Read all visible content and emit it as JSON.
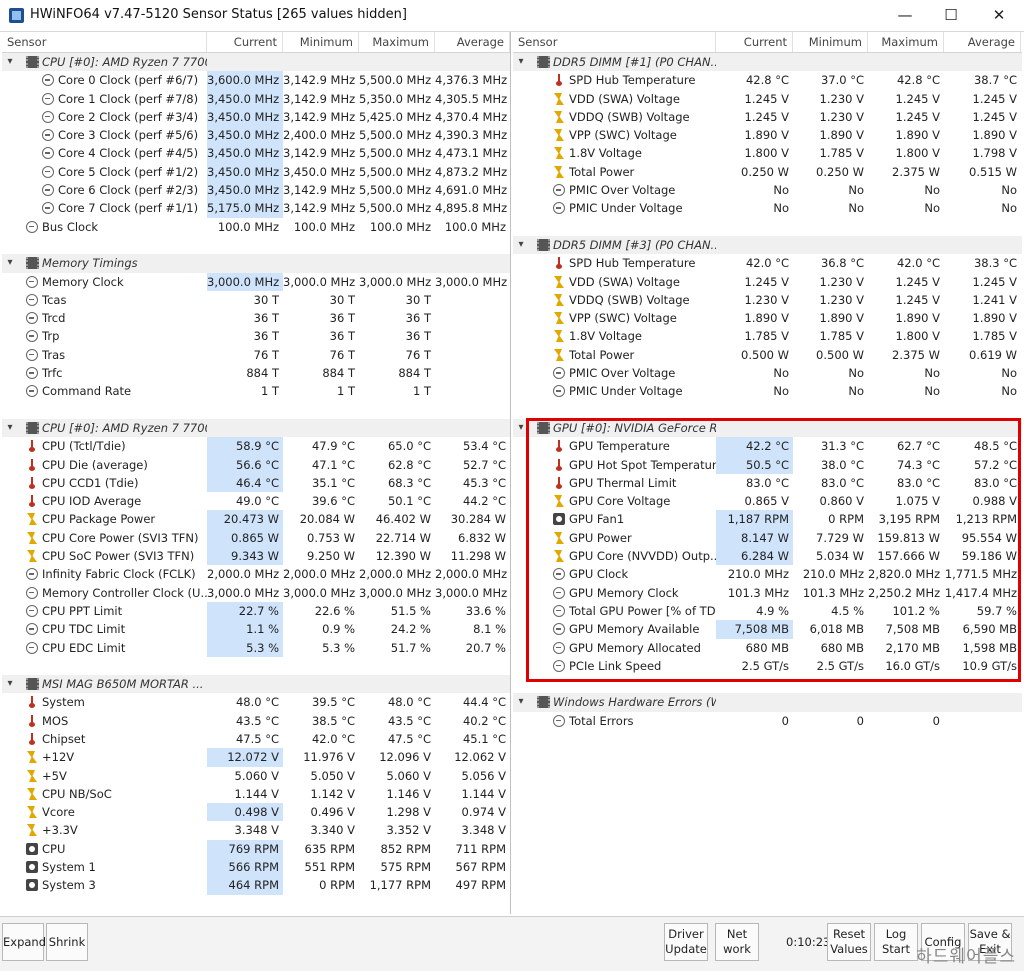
{
  "window": {
    "title": "HWiNFO64 v7.47-5120 Sensor Status [265 values hidden]",
    "minimize": "—",
    "maximize": "☐",
    "close": "✕"
  },
  "columns": [
    "Sensor",
    "Current",
    "Minimum",
    "Maximum",
    "Average"
  ],
  "left_rows": [
    {
      "type": "group",
      "name": "CPU [#0]: AMD Ryzen 7 7700X"
    },
    {
      "type": "item",
      "icon": "clock",
      "name": "Core 0 Clock (perf #6/7)",
      "cur": "3,600.0 MHz",
      "min": "3,142.9 MHz",
      "max": "5,500.0 MHz",
      "avg": "4,376.3 MHz",
      "hl": true
    },
    {
      "type": "item",
      "icon": "clock",
      "name": "Core 1 Clock (perf #7/8)",
      "cur": "3,450.0 MHz",
      "min": "3,142.9 MHz",
      "max": "5,350.0 MHz",
      "avg": "4,305.5 MHz",
      "hl": true
    },
    {
      "type": "item",
      "icon": "clock",
      "name": "Core 2 Clock (perf #3/4)",
      "cur": "3,450.0 MHz",
      "min": "3,142.9 MHz",
      "max": "5,425.0 MHz",
      "avg": "4,370.4 MHz",
      "hl": true
    },
    {
      "type": "item",
      "icon": "clock",
      "name": "Core 3 Clock (perf #5/6)",
      "cur": "3,450.0 MHz",
      "min": "2,400.0 MHz",
      "max": "5,500.0 MHz",
      "avg": "4,390.3 MHz",
      "hl": true
    },
    {
      "type": "item",
      "icon": "clock",
      "name": "Core 4 Clock (perf #4/5)",
      "cur": "3,450.0 MHz",
      "min": "3,142.9 MHz",
      "max": "5,500.0 MHz",
      "avg": "4,473.1 MHz",
      "hl": true
    },
    {
      "type": "item",
      "icon": "clock",
      "name": "Core 5 Clock (perf #1/2)",
      "cur": "3,450.0 MHz",
      "min": "3,450.0 MHz",
      "max": "5,500.0 MHz",
      "avg": "4,873.2 MHz",
      "hl": true
    },
    {
      "type": "item",
      "icon": "clock",
      "name": "Core 6 Clock (perf #2/3)",
      "cur": "3,450.0 MHz",
      "min": "3,142.9 MHz",
      "max": "5,500.0 MHz",
      "avg": "4,691.0 MHz",
      "hl": true
    },
    {
      "type": "item",
      "icon": "clock",
      "name": "Core 7 Clock (perf #1/1)",
      "cur": "5,175.0 MHz",
      "min": "3,142.9 MHz",
      "max": "5,500.0 MHz",
      "avg": "4,895.8 MHz",
      "hl": true
    },
    {
      "type": "item",
      "icon": "clock",
      "name": "Bus Clock",
      "cur": "100.0 MHz",
      "min": "100.0 MHz",
      "max": "100.0 MHz",
      "avg": "100.0 MHz",
      "lvl": 1
    },
    {
      "type": "empty"
    },
    {
      "type": "group",
      "name": "Memory Timings"
    },
    {
      "type": "item",
      "icon": "clock",
      "name": "Memory Clock",
      "cur": "3,000.0 MHz",
      "min": "3,000.0 MHz",
      "max": "3,000.0 MHz",
      "avg": "3,000.0 MHz",
      "hl": true,
      "lvl": 1
    },
    {
      "type": "item",
      "icon": "clock",
      "name": "Tcas",
      "cur": "30 T",
      "min": "30 T",
      "max": "30 T",
      "avg": "",
      "lvl": 1
    },
    {
      "type": "item",
      "icon": "clock",
      "name": "Trcd",
      "cur": "36 T",
      "min": "36 T",
      "max": "36 T",
      "avg": "",
      "lvl": 1
    },
    {
      "type": "item",
      "icon": "clock",
      "name": "Trp",
      "cur": "36 T",
      "min": "36 T",
      "max": "36 T",
      "avg": "",
      "lvl": 1
    },
    {
      "type": "item",
      "icon": "clock",
      "name": "Tras",
      "cur": "76 T",
      "min": "76 T",
      "max": "76 T",
      "avg": "",
      "lvl": 1
    },
    {
      "type": "item",
      "icon": "clock",
      "name": "Trfc",
      "cur": "884 T",
      "min": "884 T",
      "max": "884 T",
      "avg": "",
      "lvl": 1
    },
    {
      "type": "item",
      "icon": "clock",
      "name": "Command Rate",
      "cur": "1 T",
      "min": "1 T",
      "max": "1 T",
      "avg": "",
      "lvl": 1
    },
    {
      "type": "empty"
    },
    {
      "type": "group",
      "name": "CPU [#0]: AMD Ryzen 7 7700..."
    },
    {
      "type": "item",
      "icon": "temp",
      "name": "CPU (Tctl/Tdie)",
      "cur": "58.9 °C",
      "min": "47.9 °C",
      "max": "65.0 °C",
      "avg": "53.4 °C",
      "hl": true,
      "lvl": 1
    },
    {
      "type": "item",
      "icon": "temp",
      "name": "CPU Die (average)",
      "cur": "56.6 °C",
      "min": "47.1 °C",
      "max": "62.8 °C",
      "avg": "52.7 °C",
      "hl": true,
      "lvl": 1
    },
    {
      "type": "item",
      "icon": "temp",
      "name": "CPU CCD1 (Tdie)",
      "cur": "46.4 °C",
      "min": "35.1 °C",
      "max": "68.3 °C",
      "avg": "45.3 °C",
      "hl": true,
      "lvl": 1
    },
    {
      "type": "item",
      "icon": "temp",
      "name": "CPU IOD Average",
      "cur": "49.0 °C",
      "min": "39.6 °C",
      "max": "50.1 °C",
      "avg": "44.2 °C",
      "lvl": 1
    },
    {
      "type": "item",
      "icon": "volt",
      "name": "CPU Package Power",
      "cur": "20.473 W",
      "min": "20.084 W",
      "max": "46.402 W",
      "avg": "30.284 W",
      "hl": true,
      "lvl": 1
    },
    {
      "type": "item",
      "icon": "volt",
      "name": "CPU Core Power (SVI3 TFN)",
      "cur": "0.865 W",
      "min": "0.753 W",
      "max": "22.714 W",
      "avg": "6.832 W",
      "hl": true,
      "lvl": 1
    },
    {
      "type": "item",
      "icon": "volt",
      "name": "CPU SoC Power (SVI3 TFN)",
      "cur": "9.343 W",
      "min": "9.250 W",
      "max": "12.390 W",
      "avg": "11.298 W",
      "hl": true,
      "lvl": 1
    },
    {
      "type": "item",
      "icon": "clock",
      "name": "Infinity Fabric Clock (FCLK)",
      "cur": "2,000.0 MHz",
      "min": "2,000.0 MHz",
      "max": "2,000.0 MHz",
      "avg": "2,000.0 MHz",
      "lvl": 1
    },
    {
      "type": "item",
      "icon": "clock",
      "name": "Memory Controller Clock (U...",
      "cur": "3,000.0 MHz",
      "min": "3,000.0 MHz",
      "max": "3,000.0 MHz",
      "avg": "3,000.0 MHz",
      "lvl": 1
    },
    {
      "type": "item",
      "icon": "clock",
      "name": "CPU PPT Limit",
      "cur": "22.7 %",
      "min": "22.6 %",
      "max": "51.5 %",
      "avg": "33.6 %",
      "hl": true,
      "lvl": 1
    },
    {
      "type": "item",
      "icon": "clock",
      "name": "CPU TDC Limit",
      "cur": "1.1 %",
      "min": "0.9 %",
      "max": "24.2 %",
      "avg": "8.1 %",
      "hl": true,
      "lvl": 1
    },
    {
      "type": "item",
      "icon": "clock",
      "name": "CPU EDC Limit",
      "cur": "5.3 %",
      "min": "5.3 %",
      "max": "51.7 %",
      "avg": "20.7 %",
      "hl": true,
      "lvl": 1
    },
    {
      "type": "empty"
    },
    {
      "type": "group",
      "name": "MSI MAG B650M MORTAR ..."
    },
    {
      "type": "item",
      "icon": "temp",
      "name": "System",
      "cur": "48.0 °C",
      "min": "39.5 °C",
      "max": "48.0 °C",
      "avg": "44.4 °C",
      "lvl": 1
    },
    {
      "type": "item",
      "icon": "temp",
      "name": "MOS",
      "cur": "43.5 °C",
      "min": "38.5 °C",
      "max": "43.5 °C",
      "avg": "40.2 °C",
      "lvl": 1
    },
    {
      "type": "item",
      "icon": "temp",
      "name": "Chipset",
      "cur": "47.5 °C",
      "min": "42.0 °C",
      "max": "47.5 °C",
      "avg": "45.1 °C",
      "lvl": 1
    },
    {
      "type": "item",
      "icon": "volt",
      "name": "+12V",
      "cur": "12.072 V",
      "min": "11.976 V",
      "max": "12.096 V",
      "avg": "12.062 V",
      "hl": true,
      "lvl": 1
    },
    {
      "type": "item",
      "icon": "volt",
      "name": "+5V",
      "cur": "5.060 V",
      "min": "5.050 V",
      "max": "5.060 V",
      "avg": "5.056 V",
      "lvl": 1
    },
    {
      "type": "item",
      "icon": "volt",
      "name": "CPU NB/SoC",
      "cur": "1.144 V",
      "min": "1.142 V",
      "max": "1.146 V",
      "avg": "1.144 V",
      "lvl": 1
    },
    {
      "type": "item",
      "icon": "volt",
      "name": "Vcore",
      "cur": "0.498 V",
      "min": "0.496 V",
      "max": "1.298 V",
      "avg": "0.974 V",
      "hl": true,
      "lvl": 1
    },
    {
      "type": "item",
      "icon": "volt",
      "name": "+3.3V",
      "cur": "3.348 V",
      "min": "3.340 V",
      "max": "3.352 V",
      "avg": "3.348 V",
      "lvl": 1
    },
    {
      "type": "item",
      "icon": "fan",
      "name": "CPU",
      "cur": "769 RPM",
      "min": "635 RPM",
      "max": "852 RPM",
      "avg": "711 RPM",
      "hl": true,
      "lvl": 1
    },
    {
      "type": "item",
      "icon": "fan",
      "name": "System 1",
      "cur": "566 RPM",
      "min": "551 RPM",
      "max": "575 RPM",
      "avg": "567 RPM",
      "hl": true,
      "lvl": 1
    },
    {
      "type": "item",
      "icon": "fan",
      "name": "System 3",
      "cur": "464 RPM",
      "min": "0 RPM",
      "max": "1,177 RPM",
      "avg": "497 RPM",
      "hl": true,
      "lvl": 1
    }
  ],
  "right_rows": [
    {
      "type": "group",
      "name": "DDR5 DIMM [#1] (P0 CHAN..."
    },
    {
      "type": "item",
      "icon": "temp",
      "name": "SPD Hub Temperature",
      "cur": "42.8 °C",
      "min": "37.0 °C",
      "max": "42.8 °C",
      "avg": "38.7 °C"
    },
    {
      "type": "item",
      "icon": "volt",
      "name": "VDD (SWA) Voltage",
      "cur": "1.245 V",
      "min": "1.230 V",
      "max": "1.245 V",
      "avg": "1.245 V"
    },
    {
      "type": "item",
      "icon": "volt",
      "name": "VDDQ (SWB) Voltage",
      "cur": "1.245 V",
      "min": "1.230 V",
      "max": "1.245 V",
      "avg": "1.245 V"
    },
    {
      "type": "item",
      "icon": "volt",
      "name": "VPP (SWC) Voltage",
      "cur": "1.890 V",
      "min": "1.890 V",
      "max": "1.890 V",
      "avg": "1.890 V"
    },
    {
      "type": "item",
      "icon": "volt",
      "name": "1.8V Voltage",
      "cur": "1.800 V",
      "min": "1.785 V",
      "max": "1.800 V",
      "avg": "1.798 V"
    },
    {
      "type": "item",
      "icon": "volt",
      "name": "Total Power",
      "cur": "0.250 W",
      "min": "0.250 W",
      "max": "2.375 W",
      "avg": "0.515 W"
    },
    {
      "type": "item",
      "icon": "clock",
      "name": "PMIC Over Voltage",
      "cur": "No",
      "min": "No",
      "max": "No",
      "avg": "No"
    },
    {
      "type": "item",
      "icon": "clock",
      "name": "PMIC Under Voltage",
      "cur": "No",
      "min": "No",
      "max": "No",
      "avg": "No"
    },
    {
      "type": "empty"
    },
    {
      "type": "group",
      "name": "DDR5 DIMM [#3] (P0 CHAN..."
    },
    {
      "type": "item",
      "icon": "temp",
      "name": "SPD Hub Temperature",
      "cur": "42.0 °C",
      "min": "36.8 °C",
      "max": "42.0 °C",
      "avg": "38.3 °C"
    },
    {
      "type": "item",
      "icon": "volt",
      "name": "VDD (SWA) Voltage",
      "cur": "1.245 V",
      "min": "1.230 V",
      "max": "1.245 V",
      "avg": "1.245 V"
    },
    {
      "type": "item",
      "icon": "volt",
      "name": "VDDQ (SWB) Voltage",
      "cur": "1.230 V",
      "min": "1.230 V",
      "max": "1.245 V",
      "avg": "1.241 V"
    },
    {
      "type": "item",
      "icon": "volt",
      "name": "VPP (SWC) Voltage",
      "cur": "1.890 V",
      "min": "1.890 V",
      "max": "1.890 V",
      "avg": "1.890 V"
    },
    {
      "type": "item",
      "icon": "volt",
      "name": "1.8V Voltage",
      "cur": "1.785 V",
      "min": "1.785 V",
      "max": "1.800 V",
      "avg": "1.785 V"
    },
    {
      "type": "item",
      "icon": "volt",
      "name": "Total Power",
      "cur": "0.500 W",
      "min": "0.500 W",
      "max": "2.375 W",
      "avg": "0.619 W"
    },
    {
      "type": "item",
      "icon": "clock",
      "name": "PMIC Over Voltage",
      "cur": "No",
      "min": "No",
      "max": "No",
      "avg": "No"
    },
    {
      "type": "item",
      "icon": "clock",
      "name": "PMIC Under Voltage",
      "cur": "No",
      "min": "No",
      "max": "No",
      "avg": "No"
    },
    {
      "type": "empty"
    },
    {
      "type": "group",
      "name": "GPU [#0]: NVIDIA GeForce R..."
    },
    {
      "type": "item",
      "icon": "temp",
      "name": "GPU Temperature",
      "cur": "42.2 °C",
      "min": "31.3 °C",
      "max": "62.7 °C",
      "avg": "48.5 °C",
      "hl": true
    },
    {
      "type": "item",
      "icon": "temp",
      "name": "GPU Hot Spot Temperature",
      "cur": "50.5 °C",
      "min": "38.0 °C",
      "max": "74.3 °C",
      "avg": "57.2 °C",
      "hl": true
    },
    {
      "type": "item",
      "icon": "temp",
      "name": "GPU Thermal Limit",
      "cur": "83.0 °C",
      "min": "83.0 °C",
      "max": "83.0 °C",
      "avg": "83.0 °C"
    },
    {
      "type": "item",
      "icon": "volt",
      "name": "GPU Core Voltage",
      "cur": "0.865 V",
      "min": "0.860 V",
      "max": "1.075 V",
      "avg": "0.988 V"
    },
    {
      "type": "item",
      "icon": "fan",
      "name": "GPU Fan1",
      "cur": "1,187 RPM",
      "min": "0 RPM",
      "max": "3,195 RPM",
      "avg": "1,213 RPM",
      "hl": true
    },
    {
      "type": "item",
      "icon": "volt",
      "name": "GPU Power",
      "cur": "8.147 W",
      "min": "7.729 W",
      "max": "159.813 W",
      "avg": "95.554 W",
      "hl": true
    },
    {
      "type": "item",
      "icon": "volt",
      "name": "GPU Core (NVVDD) Outp...",
      "cur": "6.284 W",
      "min": "5.034 W",
      "max": "157.666 W",
      "avg": "59.186 W",
      "hl": true,
      "lvl": 1
    },
    {
      "type": "item",
      "icon": "clock",
      "name": "GPU Clock",
      "cur": "210.0 MHz",
      "min": "210.0 MHz",
      "max": "2,820.0 MHz",
      "avg": "1,771.5 MHz"
    },
    {
      "type": "item",
      "icon": "clock",
      "name": "GPU Memory Clock",
      "cur": "101.3 MHz",
      "min": "101.3 MHz",
      "max": "2,250.2 MHz",
      "avg": "1,417.4 MHz"
    },
    {
      "type": "item",
      "icon": "clock",
      "name": "Total GPU Power [% of TDP]",
      "cur": "4.9 %",
      "min": "4.5 %",
      "max": "101.2 %",
      "avg": "59.7 %"
    },
    {
      "type": "item",
      "icon": "clock",
      "name": "GPU Memory Available",
      "cur": "7,508 MB",
      "min": "6,018 MB",
      "max": "7,508 MB",
      "avg": "6,590 MB",
      "hl": true
    },
    {
      "type": "item",
      "icon": "clock",
      "name": "GPU Memory Allocated",
      "cur": "680 MB",
      "min": "680 MB",
      "max": "2,170 MB",
      "avg": "1,598 MB"
    },
    {
      "type": "item",
      "icon": "clock",
      "name": "PCIe Link Speed",
      "cur": "2.5 GT/s",
      "min": "2.5 GT/s",
      "max": "16.0 GT/s",
      "avg": "10.9 GT/s"
    },
    {
      "type": "empty"
    },
    {
      "type": "group",
      "name": "Windows Hardware Errors (W..."
    },
    {
      "type": "item",
      "icon": "clock",
      "name": "Total Errors",
      "cur": "0",
      "min": "0",
      "max": "0",
      "avg": ""
    }
  ],
  "bottom": {
    "expand": "Expand",
    "shrink": "Shrink",
    "driver_update": [
      "Driver",
      "Update"
    ],
    "net_work": [
      "Net",
      "work"
    ],
    "timer": "0:10:23",
    "reset_values": [
      "Reset",
      "Values"
    ],
    "log_start": [
      "Log",
      "Start"
    ],
    "config": "Config",
    "save": [
      "Save &",
      "Exit"
    ]
  },
  "watermark": "하드웨어플스",
  "colors": {
    "highlight": "#cfe4fb",
    "redbox": "#e00000"
  }
}
